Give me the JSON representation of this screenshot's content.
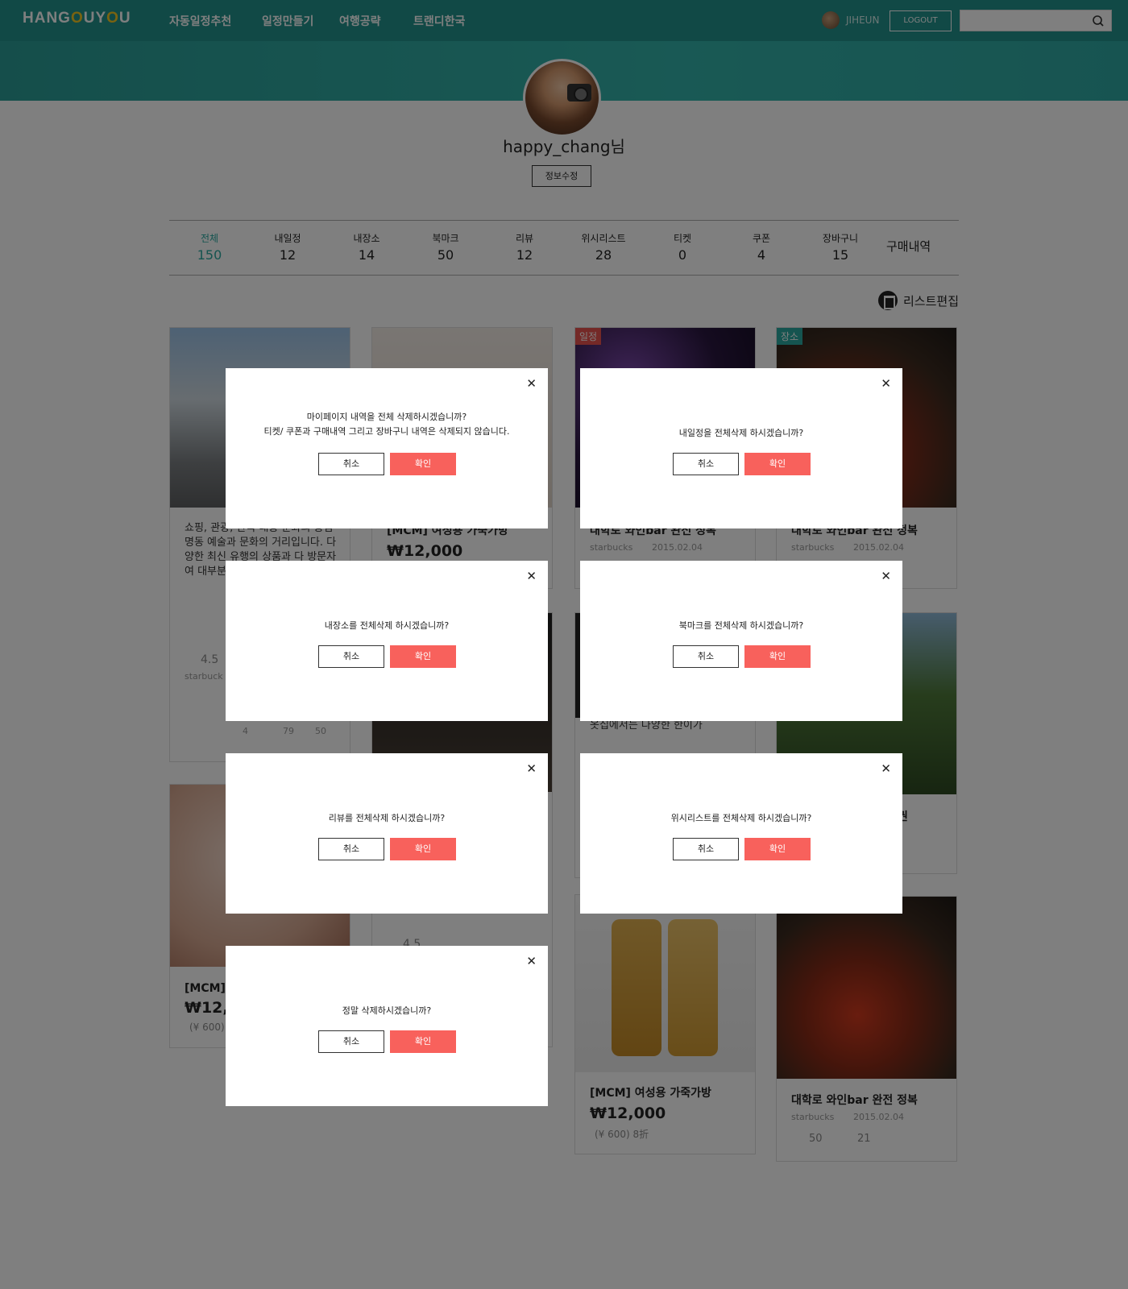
{
  "header": {
    "logo": "HANGOUYOU",
    "nav": [
      "자동일정추천",
      "일정만들기",
      "여행공략",
      "트랜디한국"
    ],
    "user": "JIHEUN",
    "logout_label": "LOGOUT",
    "search_placeholder": ""
  },
  "profile": {
    "name": "happy_chang님",
    "edit_label": "정보수정"
  },
  "stats": [
    {
      "label": "전체",
      "value": "150"
    },
    {
      "label": "내일정",
      "value": "12"
    },
    {
      "label": "내장소",
      "value": "14"
    },
    {
      "label": "북마크",
      "value": "50"
    },
    {
      "label": "리뷰",
      "value": "12"
    },
    {
      "label": "위시리스트",
      "value": "28"
    },
    {
      "label": "티켓",
      "value": "0"
    },
    {
      "label": "쿠폰",
      "value": "4"
    },
    {
      "label": "장바구니",
      "value": "15"
    }
  ],
  "stat_buy": "구매내역",
  "list_edit": "리스트편집",
  "cards": {
    "c1_desc": "쇼핑, 관광, 한국 대중 문화의 중심 명동 예술과 문화의 거리입니다. 다양한 최신 유행의 상품과 다 방문자 여 대부분의 옷집에서",
    "c1_rating": "4.5",
    "c1_meta": "starbuck",
    "c1_counts": [
      "4",
      "79",
      "50"
    ],
    "c2_title": "[MCM] 여성용 가죽가방",
    "c2_price": "₩12,000",
    "c3_badge": "일정",
    "c3_title": "대학로 와인bar 완전 정복",
    "c3_meta": "starbucks",
    "c3_date": "2015.02.04",
    "c4_badge": "장소",
    "c4_title": "대학로 와인bar 완전 정복",
    "c4_meta": "starbucks",
    "c4_date": "2015.02.04",
    "c5_title": "[MCM] 여",
    "c5_price": "₩12,0",
    "c5_sub": "(¥ 600)",
    "c6_title": "[MCM] 여성용 가죽가방",
    "c6_price": "₩12,000",
    "c6_sub": "(¥ 600) 8折",
    "c7_title": "대학로 와인bar 완전 정복",
    "c7_meta": "starbucks",
    "c7_date": "2015.02.04",
    "c7_likes": "50",
    "c7_comments": "21",
    "c8_snippet": "옷집에서는 다양한 한이가",
    "c9_snippet": "권",
    "c10_rating": "4.5"
  },
  "modals": [
    {
      "msg1": "마이페이지 내역을 전체 삭제하시겠습니까?",
      "msg2": "티켓/ 쿠폰과 구매내역 그리고 장바구니 내역은 삭제되지 않습니다.",
      "cancel": "취소",
      "ok": "확인"
    },
    {
      "msg1": "내일정을 전체삭제 하시겠습니까?",
      "cancel": "취소",
      "ok": "확인"
    },
    {
      "msg1": "내장소를 전체삭제 하시겠습니까?",
      "cancel": "취소",
      "ok": "확인"
    },
    {
      "msg1": "북마크를 전체삭제 하시겠습니까?",
      "cancel": "취소",
      "ok": "확인"
    },
    {
      "msg1": "리뷰를 전체삭제 하시겠습니까?",
      "cancel": "취소",
      "ok": "확인"
    },
    {
      "msg1": "위시리스트를 전체삭제 하시겠습니까?",
      "cancel": "취소",
      "ok": "확인"
    },
    {
      "msg1": "정말 삭제하시겠습니까?",
      "cancel": "취소",
      "ok": "확인"
    }
  ],
  "colors": {
    "accent": "#2aa9a0",
    "confirm": "#f8615c",
    "badge_schedule": "#e9534f",
    "badge_place": "#2aa9a0"
  }
}
